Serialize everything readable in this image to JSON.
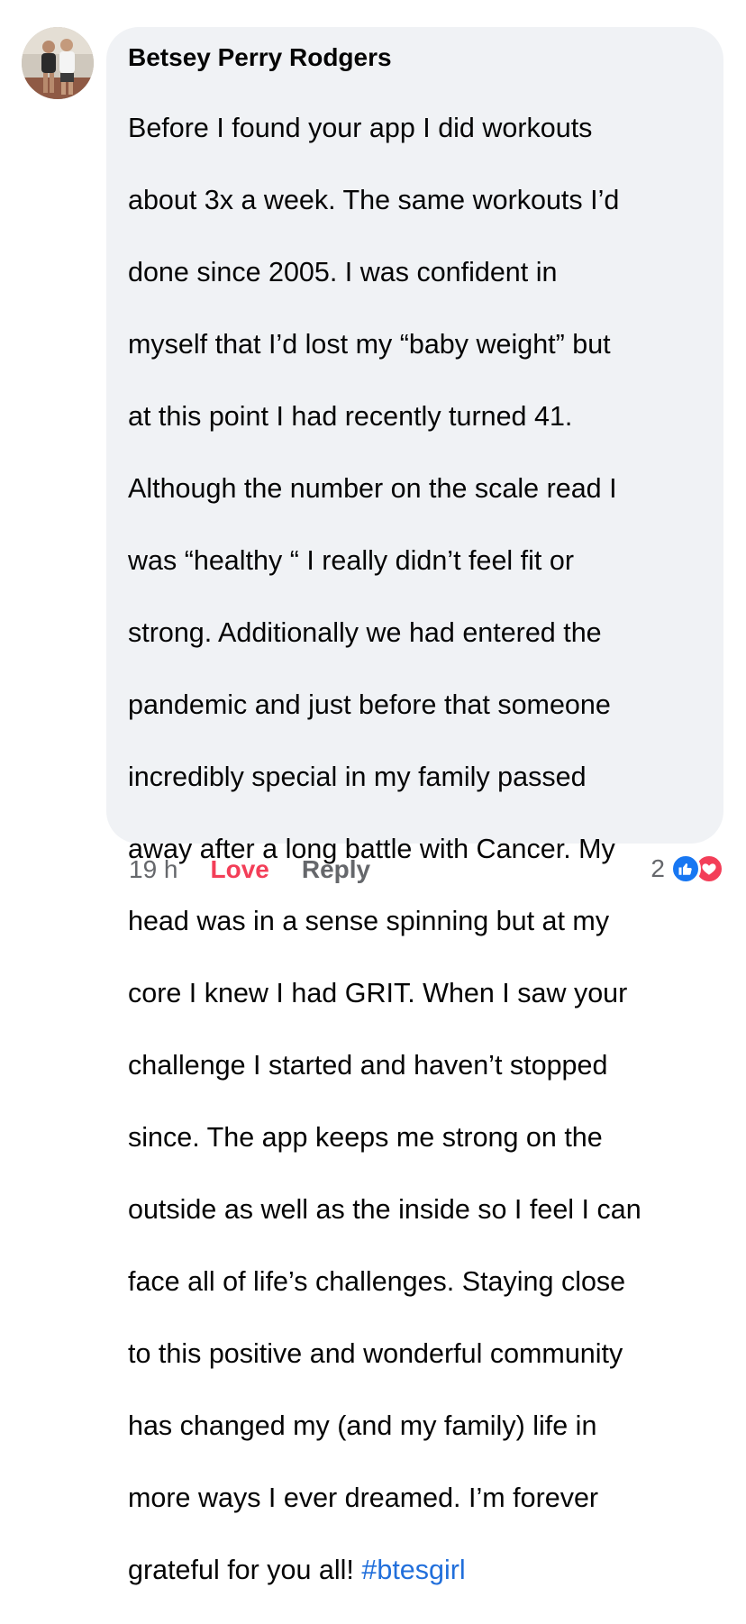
{
  "comment": {
    "author": "Betsey Perry Rodgers",
    "text_lines": [
      "Before I found your app I did workouts",
      "about 3x a week. The same workouts I’d",
      "done since 2005. I was confident in",
      "myself that I’d lost my “baby weight” but",
      "at this point I had recently turned 41.",
      "Although the number on the scale read I",
      "was “healthy “ I really didn’t feel fit or",
      "strong. Additionally we had entered the",
      "pandemic and just before that someone",
      "incredibly special in my family passed",
      "away after a long battle with Cancer. My",
      "head was in a sense spinning but at my",
      "core I knew I had GRIT. When I saw your",
      "challenge I started and haven’t stopped",
      "since. The app keeps me strong on the",
      "outside as well as the inside  so I feel I can",
      "face all of life’s challenges. Staying close",
      "to this positive and wonderful community",
      "has changed my (and my family) life in",
      "more ways I ever dreamed. I’m forever"
    ],
    "last_line_text": "grateful for you all! ",
    "hashtag": "#btesgirl",
    "timestamp": "19 h",
    "love_label": "Love",
    "reply_label": "Reply",
    "reaction_count": "2",
    "reactions": [
      "like-icon",
      "heart-icon"
    ]
  },
  "colors": {
    "bubble_bg": "#f0f2f5",
    "hashtag": "#216fdb",
    "love": "#f33e58",
    "like": "#1877f2",
    "secondary_text": "#65676b"
  }
}
